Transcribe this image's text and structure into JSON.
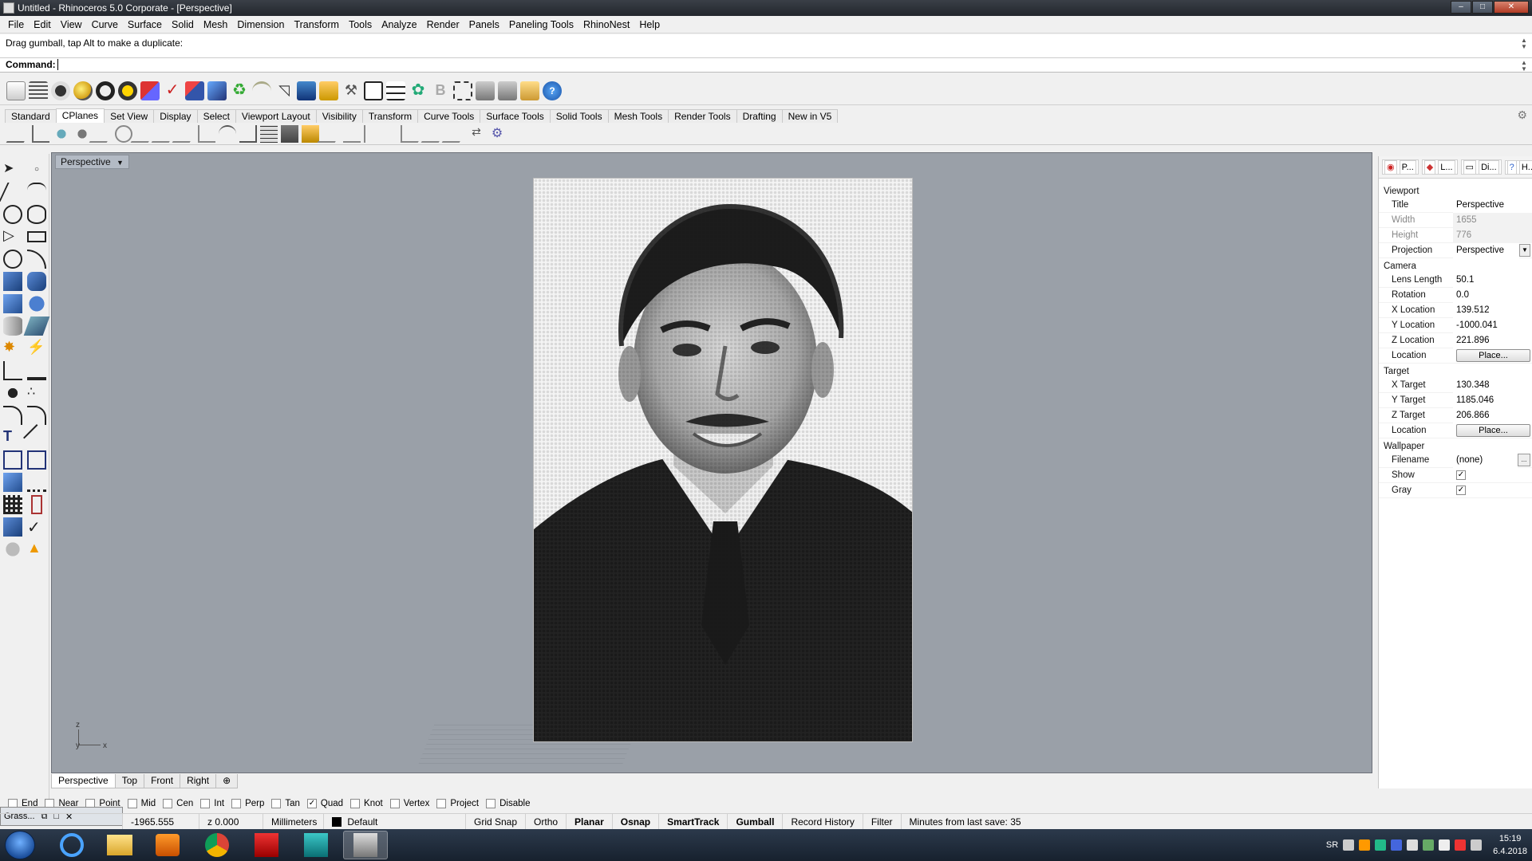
{
  "window": {
    "title": "Untitled - Rhinoceros  5.0 Corporate - [Perspective]",
    "controls": [
      "–",
      "□",
      "✕"
    ]
  },
  "menu": [
    "File",
    "Edit",
    "View",
    "Curve",
    "Surface",
    "Solid",
    "Mesh",
    "Dimension",
    "Transform",
    "Tools",
    "Analyze",
    "Render",
    "Panels",
    "Paneling Tools",
    "RhinoNest",
    "Help"
  ],
  "command": {
    "history": "Drag gumball, tap Alt to make a duplicate:",
    "prompt": "Command:",
    "value": ""
  },
  "toolbar_tabs": [
    "Standard",
    "CPlanes",
    "Set View",
    "Display",
    "Select",
    "Viewport Layout",
    "Visibility",
    "Transform",
    "Curve Tools",
    "Surface Tools",
    "Solid Tools",
    "Mesh Tools",
    "Render Tools",
    "Drafting",
    "New in V5"
  ],
  "toolbar_tabs_active": "CPlanes",
  "viewport": {
    "title": "Perspective",
    "axes": {
      "z": "z",
      "y": "y",
      "x": "x"
    }
  },
  "viewport_tabs": [
    "Perspective",
    "Top",
    "Front",
    "Right",
    "⊕"
  ],
  "osnap": [
    {
      "label": "End",
      "checked": false
    },
    {
      "label": "Near",
      "checked": false
    },
    {
      "label": "Point",
      "checked": false
    },
    {
      "label": "Mid",
      "checked": false
    },
    {
      "label": "Cen",
      "checked": false
    },
    {
      "label": "Int",
      "checked": false
    },
    {
      "label": "Perp",
      "checked": false
    },
    {
      "label": "Tan",
      "checked": false
    },
    {
      "label": "Quad",
      "checked": true
    },
    {
      "label": "Knot",
      "checked": false
    },
    {
      "label": "Vertex",
      "checked": false
    },
    {
      "label": "Project",
      "checked": false
    },
    {
      "label": "Disable",
      "checked": false
    }
  ],
  "status": {
    "popup_label": "Grass...",
    "coord_y": "-1965.555",
    "coord_z": "z 0.000",
    "units": "Millimeters",
    "layer": "Default",
    "grid_snap": "Grid Snap",
    "ortho": "Ortho",
    "planar": "Planar",
    "osnap": "Osnap",
    "smarttrack": "SmartTrack",
    "gumball": "Gumball",
    "record_history": "Record History",
    "filter": "Filter",
    "last_save": "Minutes from last save: 35"
  },
  "panel": {
    "tabs": [
      "P...",
      "L...",
      "Di...",
      "H..."
    ],
    "viewport_section": "Viewport",
    "title_label": "Title",
    "title_value": "Perspective",
    "width_label": "Width",
    "width_value": "1655",
    "height_label": "Height",
    "height_value": "776",
    "projection_label": "Projection",
    "projection_value": "Perspective",
    "camera_section": "Camera",
    "lens_label": "Lens Length",
    "lens_value": "50.1",
    "rotation_label": "Rotation",
    "rotation_value": "0.0",
    "xloc_label": "X Location",
    "xloc_value": "139.512",
    "yloc_label": "Y Location",
    "yloc_value": "-1000.041",
    "zloc_label": "Z Location",
    "zloc_value": "221.896",
    "loc_label": "Location",
    "place_btn": "Place...",
    "target_section": "Target",
    "xt_label": "X Target",
    "xt_value": "130.348",
    "yt_label": "Y Target",
    "yt_value": "1185.046",
    "zt_label": "Z Target",
    "zt_value": "206.866",
    "tloc_label": "Location",
    "tplace_btn": "Place...",
    "wallpaper_section": "Wallpaper",
    "filename_label": "Filename",
    "filename_value": "(none)",
    "filename_btn": "...",
    "show_label": "Show",
    "show_checked": true,
    "gray_label": "Gray",
    "gray_checked": true
  },
  "taskbar": {
    "lang": "SR",
    "time": "15:19",
    "date": "6.4.2018"
  }
}
